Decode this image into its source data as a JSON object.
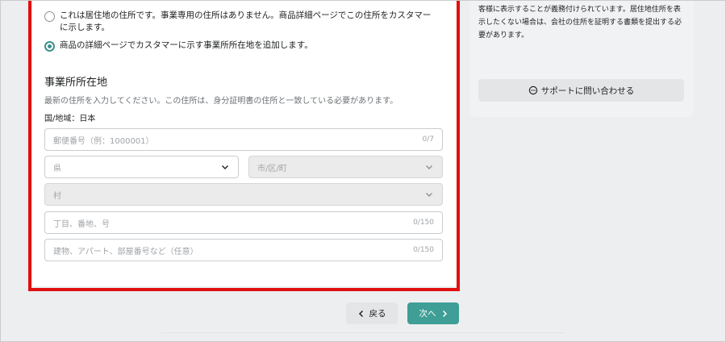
{
  "address_type": {
    "option_residential": "これは居住地の住所です。事業専用の住所はありません。商品詳細ページでこの住所をカスタマーに示します。",
    "option_business": "商品の詳細ページでカスタマーに示す事業所所在地を追加します。",
    "selected": "option_business"
  },
  "business_address": {
    "title": "事業所所在地",
    "description": "最新の住所を入力してください。この住所は、身分証明書の住所と一致している必要があります。",
    "country_label": "国/地域：日本"
  },
  "fields": {
    "postal": {
      "placeholder": "郵便番号（例：1000001）",
      "count": "0/7"
    },
    "prefecture": {
      "placeholder": "県"
    },
    "city": {
      "placeholder": "市/区/町"
    },
    "village": {
      "placeholder": "村"
    },
    "street": {
      "placeholder": "丁目、番地、号",
      "count": "0/150"
    },
    "building": {
      "placeholder": "建物、アパート、部屋番号など（任意）",
      "count": "0/150"
    }
  },
  "sidebar": {
    "notice": "客様に表示することが義務付けられています。居住地住所を表示したくない場合は、会社の住所を証明する書類を提出する必要があります。",
    "support_button": "サポートに問い合わせる"
  },
  "nav": {
    "back_label": "戻る",
    "next_label": "次へ"
  },
  "colors": {
    "accent": "#3f9e96",
    "highlight": "#e01010"
  }
}
